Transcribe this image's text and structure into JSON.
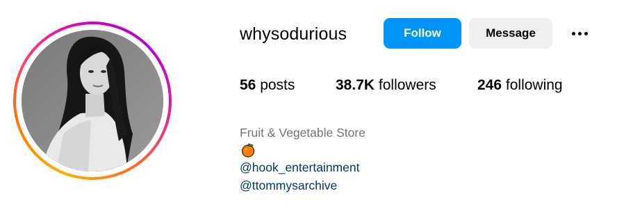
{
  "profile": {
    "username": "whysodurious",
    "follow_label": "Follow",
    "message_label": "Message",
    "more_icon": "ellipsis-icon",
    "avatar_icon": "profile-photo"
  },
  "stats": {
    "posts_count": "56",
    "posts_label": "posts",
    "followers_count": "38.7K",
    "followers_label": "followers",
    "following_count": "246",
    "following_label": "following"
  },
  "bio": {
    "category": "Fruit & Vegetable Store",
    "emoji": "tangerine-emoji",
    "links": [
      "@hook_entertainment",
      "@ttommysarchive"
    ]
  },
  "colors": {
    "follow_bg": "#0095f6",
    "message_bg": "#efefef",
    "category_text": "#737373",
    "link_text": "#00376b"
  }
}
